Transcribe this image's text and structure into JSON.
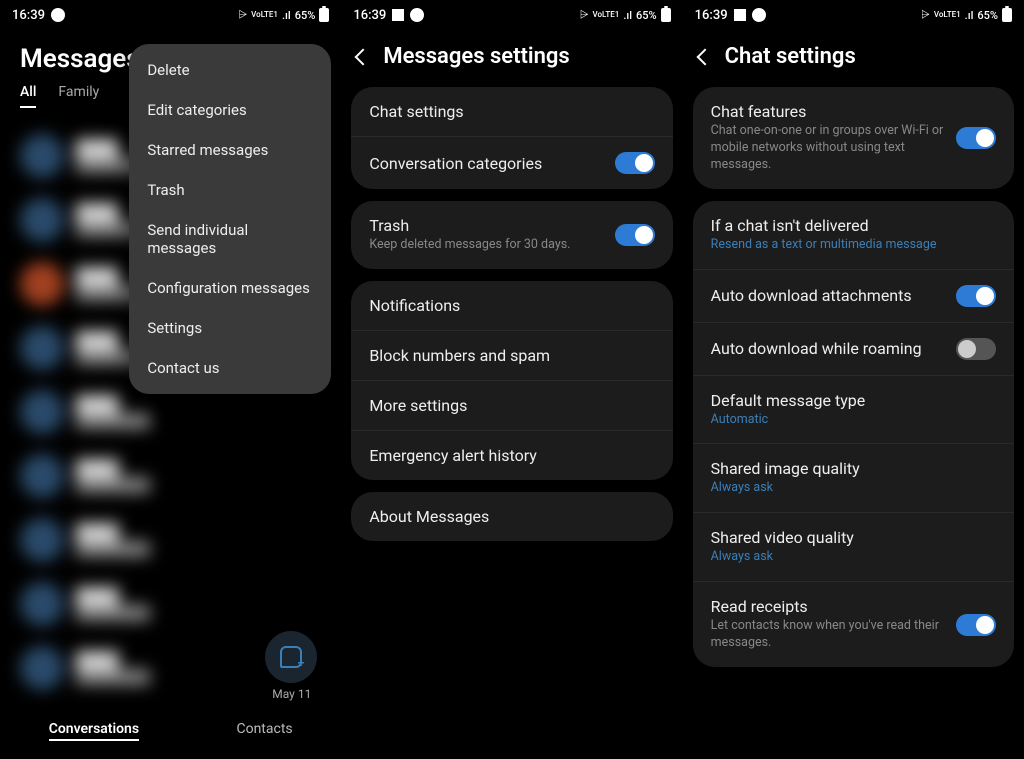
{
  "statusBar": {
    "time": "16:39",
    "volte": "VoLTE1",
    "signal": ".ıl",
    "battery": "65%"
  },
  "screen1": {
    "title": "Messages",
    "tabs": [
      "All",
      "Family"
    ],
    "popup": [
      "Delete",
      "Edit categories",
      "Starred messages",
      "Trash",
      "Send individual messages",
      "Configuration messages",
      "Settings",
      "Contact us"
    ],
    "dateBadge": "May 11",
    "bottomTabs": [
      "Conversations",
      "Contacts"
    ]
  },
  "screen2": {
    "title": "Messages settings",
    "group1": [
      {
        "title": "Chat settings"
      },
      {
        "title": "Conversation categories",
        "toggle": "on"
      }
    ],
    "group2": [
      {
        "title": "Trash",
        "sub": "Keep deleted messages for 30 days.",
        "toggle": "on"
      }
    ],
    "group3": [
      {
        "title": "Notifications"
      },
      {
        "title": "Block numbers and spam"
      },
      {
        "title": "More settings"
      },
      {
        "title": "Emergency alert history"
      }
    ],
    "group4": [
      {
        "title": "About Messages"
      }
    ]
  },
  "screen3": {
    "title": "Chat settings",
    "group1": [
      {
        "title": "Chat features",
        "sub": "Chat one-on-one or in groups over Wi-Fi or mobile networks without using text messages.",
        "toggle": "on"
      }
    ],
    "group2": [
      {
        "title": "If a chat isn't delivered",
        "sub": "Resend as a text or multimedia message",
        "accent": true
      },
      {
        "title": "Auto download attachments",
        "toggle": "on"
      },
      {
        "title": "Auto download while roaming",
        "toggle": "off"
      },
      {
        "title": "Default message type",
        "sub": "Automatic",
        "accent": true
      },
      {
        "title": "Shared image quality",
        "sub": "Always ask",
        "accent": true
      },
      {
        "title": "Shared video quality",
        "sub": "Always ask",
        "accent": true
      },
      {
        "title": "Read receipts",
        "sub": "Let contacts know when you've read their messages.",
        "toggle": "on"
      }
    ]
  }
}
